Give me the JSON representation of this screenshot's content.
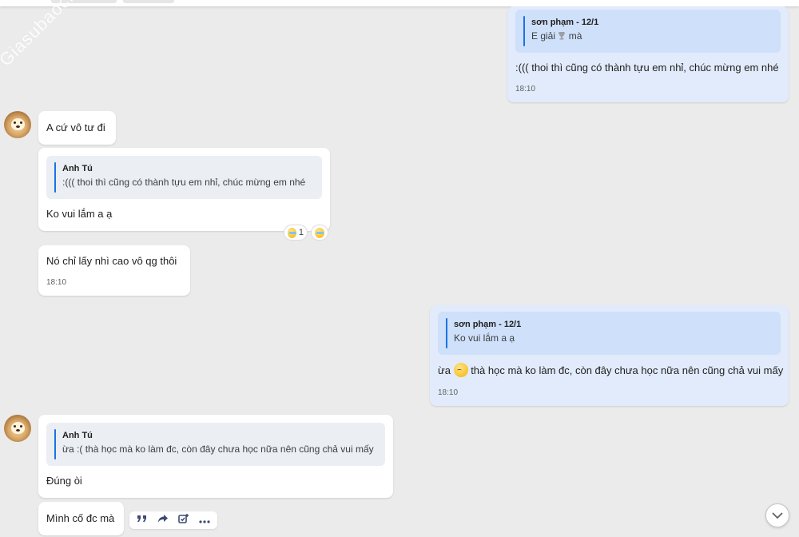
{
  "watermark": "Giasubaochau.net",
  "messages": {
    "m1": {
      "quote_author": "sơn phạm - 12/1",
      "quote_text_pre": "E giải",
      "quote_text_post": "mà",
      "text": ":((( thoi thì cũng có thành tựu em nhỉ, chúc mừng em nhé",
      "time": "18:10"
    },
    "m2": {
      "text": "A cứ vô tư đi"
    },
    "m3": {
      "quote_author": "Anh Tú",
      "quote_text": ":((( thoi thì cũng có thành tựu em nhỉ, chúc mừng em nhé",
      "text": "Ko vui lắm a ạ",
      "reaction_count": "1"
    },
    "m4": {
      "text": "Nó chỉ lấy nhì cao vô qg thôi",
      "time": "18:10"
    },
    "m5": {
      "quote_author": "sơn phạm - 12/1",
      "quote_text": "Ko vui lắm a ạ",
      "text_pre": "ừa",
      "text_post": "thà học mà ko làm đc, còn đây chưa học nữa nên cũng chả vui mấy",
      "time": "18:10"
    },
    "m6": {
      "quote_author": "Anh Tú",
      "quote_text": "ừa :( thà học mà ko làm đc, còn đây chưa học nữa nên cũng chả vui mấy",
      "text": "Đúng òi"
    },
    "m7": {
      "text": "Mình cố đc mà"
    }
  },
  "toolbar": {
    "quote_icon": "quote-icon",
    "forward_icon": "forward-icon",
    "add_task_icon": "add-task-icon",
    "more_icon": "more-icon"
  },
  "colors": {
    "outgoing_bubble": "#e2ebfb",
    "incoming_bubble": "#ffffff",
    "quote_bar": "#1a73e8",
    "background": "#ebebeb"
  }
}
